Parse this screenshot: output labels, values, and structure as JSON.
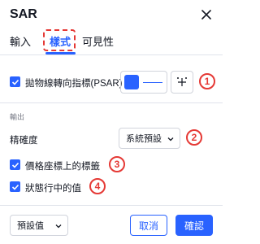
{
  "dialog": {
    "title": "SAR"
  },
  "tabs": [
    {
      "label": "輸入"
    },
    {
      "label": "樣式"
    },
    {
      "label": "可見性"
    }
  ],
  "style": {
    "psar": {
      "label": "拋物線轉向指標(PSAR)",
      "checked": true,
      "color": "#2962ff"
    },
    "output_section": "輸出",
    "precision": {
      "label": "精確度",
      "value": "系統預設"
    },
    "price_scale_labels": {
      "label": "價格座標上的標籤",
      "checked": true
    },
    "status_line_values": {
      "label": "狀態行中的值",
      "checked": true
    }
  },
  "annotations": [
    "1",
    "2",
    "3",
    "4"
  ],
  "footer": {
    "defaults_label": "預設值",
    "cancel_label": "取消",
    "ok_label": "確認"
  },
  "colors": {
    "accent": "#2962ff",
    "annotation": "#e53935"
  }
}
